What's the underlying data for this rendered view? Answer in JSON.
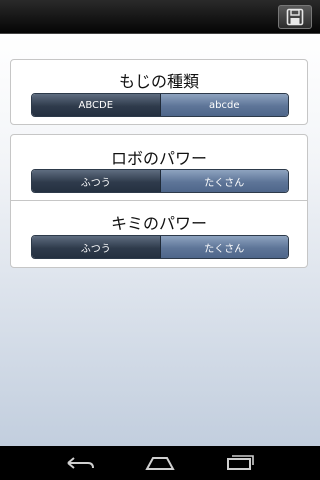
{
  "panels": [
    {
      "title": "もじの種類",
      "options": [
        "ABCDE",
        "abcde"
      ],
      "selected_index": 0
    },
    {
      "title": "ロボのパワー",
      "options": [
        "ふつう",
        "たくさん"
      ],
      "selected_index": 0
    },
    {
      "title": "キミのパワー",
      "options": [
        "ふつう",
        "たくさん"
      ],
      "selected_index": 0
    }
  ],
  "icons": {
    "save": "save-icon",
    "back": "back-icon",
    "home": "home-icon",
    "recent": "recent-apps-icon"
  },
  "colors": {
    "selected_segment": "#2f3b4c",
    "unselected_segment": "#5e7598"
  }
}
